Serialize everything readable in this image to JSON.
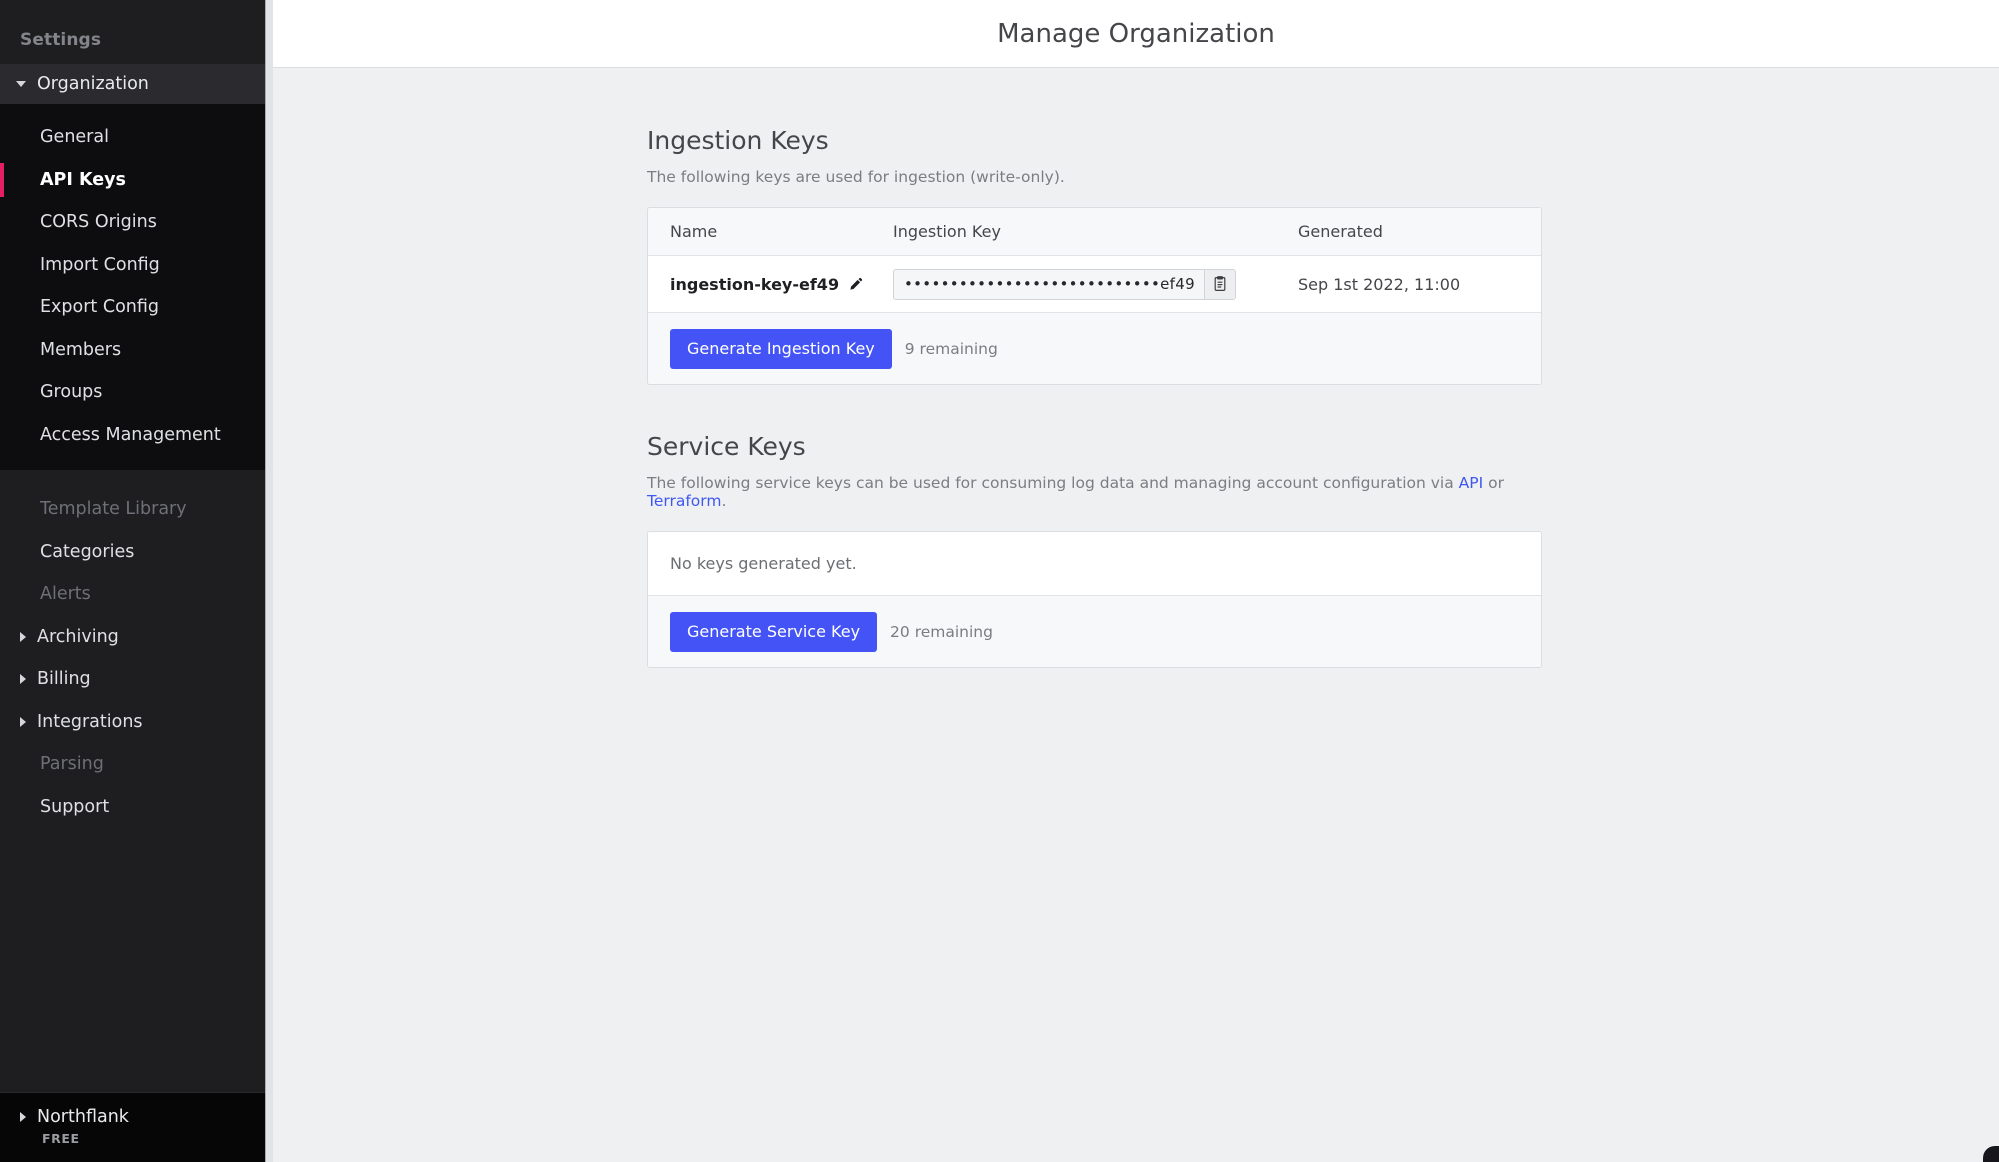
{
  "header": {
    "title": "Manage Organization"
  },
  "sidebar": {
    "settings_label": "Settings",
    "group": {
      "label": "Organization",
      "caret": "caret-down-icon"
    },
    "org_items": [
      {
        "label": "General",
        "active": false
      },
      {
        "label": "API Keys",
        "active": true
      },
      {
        "label": "CORS Origins",
        "active": false
      },
      {
        "label": "Import Config",
        "active": false
      },
      {
        "label": "Export Config",
        "active": false
      },
      {
        "label": "Members",
        "active": false
      },
      {
        "label": "Groups",
        "active": false
      },
      {
        "label": "Access Management",
        "active": false
      }
    ],
    "other_items": [
      {
        "label": "Template Library",
        "disabled": true,
        "caret": false
      },
      {
        "label": "Categories",
        "disabled": false,
        "caret": false
      },
      {
        "label": "Alerts",
        "disabled": true,
        "caret": false
      },
      {
        "label": "Archiving",
        "disabled": false,
        "caret": true
      },
      {
        "label": "Billing",
        "disabled": false,
        "caret": true
      },
      {
        "label": "Integrations",
        "disabled": false,
        "caret": true
      },
      {
        "label": "Parsing",
        "disabled": true,
        "caret": false
      },
      {
        "label": "Support",
        "disabled": false,
        "caret": false
      }
    ],
    "footer": {
      "org_name": "Northflank",
      "plan": "FREE",
      "caret": "caret-right-icon"
    },
    "active_indicator_color": "#e61e63"
  },
  "ingestion": {
    "title": "Ingestion Keys",
    "subtitle": "The following keys are used for ingestion (write-only).",
    "columns": {
      "name": "Name",
      "key": "Ingestion Key",
      "generated": "Generated"
    },
    "rows": [
      {
        "name": "ingestion-key-ef49",
        "edit_icon": "pencil-icon",
        "key_masked": "••••••••••••••••••••••••••••ef49",
        "copy_icon": "clipboard-icon",
        "generated": "Sep 1st 2022, 11:00"
      }
    ],
    "generate_label": "Generate Ingestion Key",
    "remaining": "9 remaining"
  },
  "service": {
    "title": "Service Keys",
    "subtitle_pre": "The following service keys can be used for consuming log data and managing account configuration via ",
    "link_api": "API",
    "subtitle_mid": " or ",
    "link_terraform": "Terraform",
    "subtitle_post": ".",
    "empty_text": "No keys generated yet.",
    "generate_label": "Generate Service Key",
    "remaining": "20 remaining"
  },
  "colors": {
    "accent_blue": "#4353f5",
    "link_blue": "#3f58f0",
    "active_pink": "#e61e63",
    "sidebar_bg": "#1e1e21",
    "sidebar_sub_bg": "#0d0d0f",
    "page_bg": "#eff0f2"
  }
}
